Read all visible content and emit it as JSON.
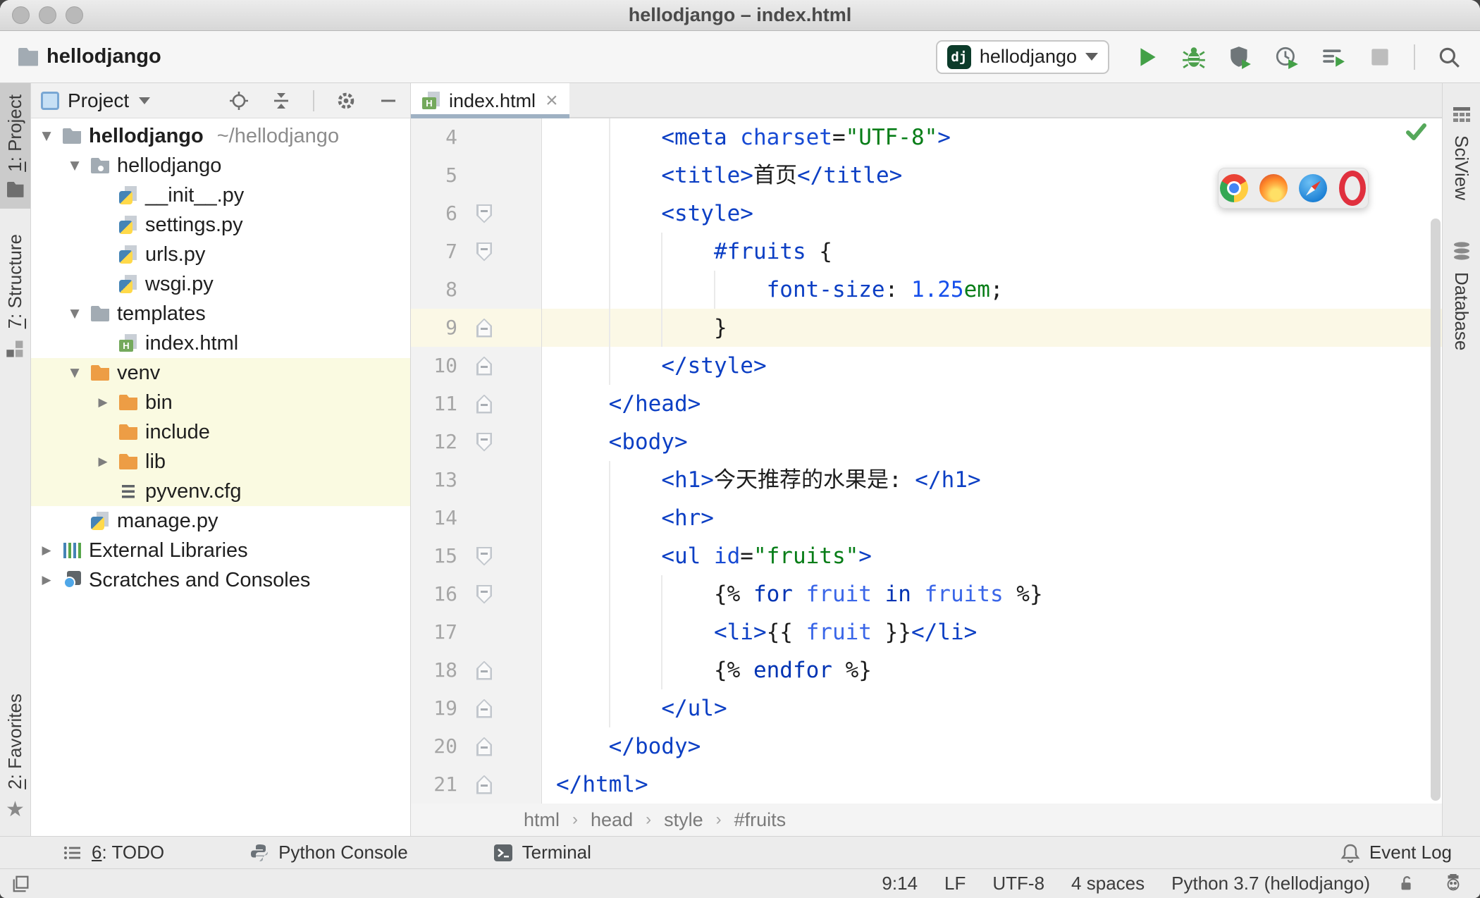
{
  "window": {
    "title": "hellodjango – index.html"
  },
  "navbar": {
    "project": "hellodjango",
    "run_badge": "dj",
    "run_config": "hellodjango"
  },
  "activity": {
    "left": [
      {
        "key": "1",
        "rest": ": Project"
      },
      {
        "key": "7",
        "rest": ": Structure"
      },
      {
        "key": "2",
        "rest": ": Favorites"
      }
    ],
    "right": [
      {
        "label": "SciView"
      },
      {
        "label": "Database"
      }
    ]
  },
  "project_panel": {
    "title": "Project",
    "tree": [
      {
        "label": "hellodjango",
        "suffix": "~/hellodjango",
        "icon": "folder",
        "level": 0,
        "arrow": "down",
        "bold": true
      },
      {
        "label": "hellodjango",
        "icon": "pkg",
        "level": 1,
        "arrow": "down"
      },
      {
        "label": "__init__.py",
        "icon": "pyfile",
        "level": 2,
        "arrow": "none"
      },
      {
        "label": "settings.py",
        "icon": "pyfile",
        "level": 2,
        "arrow": "none"
      },
      {
        "label": "urls.py",
        "icon": "pyfile",
        "level": 2,
        "arrow": "none"
      },
      {
        "label": "wsgi.py",
        "icon": "pyfile",
        "level": 2,
        "arrow": "none"
      },
      {
        "label": "templates",
        "icon": "folder",
        "level": 1,
        "arrow": "down"
      },
      {
        "label": "index.html",
        "icon": "htmlfile",
        "level": 2,
        "arrow": "none"
      },
      {
        "label": "venv",
        "icon": "ofolder",
        "level": 1,
        "arrow": "down",
        "hl": true
      },
      {
        "label": "bin",
        "icon": "ofolder",
        "level": 2,
        "arrow": "right",
        "hl": true
      },
      {
        "label": "include",
        "icon": "ofolder",
        "level": 2,
        "arrow": "none",
        "hl": true
      },
      {
        "label": "lib",
        "icon": "ofolder",
        "level": 2,
        "arrow": "right",
        "hl": true
      },
      {
        "label": "pyvenv.cfg",
        "icon": "cfgfile",
        "level": 2,
        "arrow": "none",
        "hl": true
      },
      {
        "label": "manage.py",
        "icon": "pyfile",
        "level": 1,
        "arrow": "none"
      },
      {
        "label": "External Libraries",
        "icon": "libs",
        "level": 0,
        "arrow": "right"
      },
      {
        "label": "Scratches and Consoles",
        "icon": "scratch",
        "level": 0,
        "arrow": "right"
      }
    ]
  },
  "editor": {
    "tab": "index.html",
    "breadcrumbs": [
      "html",
      "head",
      "style",
      "#fruits"
    ],
    "lines": [
      {
        "n": "4",
        "f": "",
        "hl": false,
        "t": [
          [
            "        ",
            "p"
          ],
          [
            "<meta ",
            "tag"
          ],
          [
            "charset",
            "attr"
          ],
          [
            "=",
            "p"
          ],
          [
            "\"UTF-8\"",
            "str"
          ],
          [
            ">",
            "tag"
          ]
        ]
      },
      {
        "n": "5",
        "f": "",
        "hl": false,
        "t": [
          [
            "        ",
            "p"
          ],
          [
            "<title>",
            "tag"
          ],
          [
            "首页",
            "p"
          ],
          [
            "</title>",
            "tag"
          ]
        ]
      },
      {
        "n": "6",
        "f": "d",
        "hl": false,
        "t": [
          [
            "        ",
            "p"
          ],
          [
            "<style>",
            "tag"
          ]
        ]
      },
      {
        "n": "7",
        "f": "d",
        "hl": false,
        "t": [
          [
            "            ",
            "p"
          ],
          [
            "#fruits",
            "tag"
          ],
          [
            " {",
            "p"
          ]
        ]
      },
      {
        "n": "8",
        "f": "",
        "hl": false,
        "t": [
          [
            "                ",
            "p"
          ],
          [
            "font-size",
            "tag"
          ],
          [
            ": ",
            "p"
          ],
          [
            "1.25",
            "num"
          ],
          [
            "em",
            "str"
          ],
          [
            ";",
            "p"
          ]
        ]
      },
      {
        "n": "9",
        "f": "u",
        "hl": true,
        "t": [
          [
            "            }",
            "p"
          ]
        ]
      },
      {
        "n": "10",
        "f": "u",
        "hl": false,
        "t": [
          [
            "        ",
            "p"
          ],
          [
            "</style>",
            "tag"
          ]
        ]
      },
      {
        "n": "11",
        "f": "u",
        "hl": false,
        "t": [
          [
            "    ",
            "p"
          ],
          [
            "</head>",
            "tag"
          ]
        ]
      },
      {
        "n": "12",
        "f": "d",
        "hl": false,
        "t": [
          [
            "    ",
            "p"
          ],
          [
            "<body>",
            "tag"
          ]
        ]
      },
      {
        "n": "13",
        "f": "",
        "hl": false,
        "t": [
          [
            "        ",
            "p"
          ],
          [
            "<h1>",
            "tag"
          ],
          [
            "今天推荐的水果是: ",
            "p"
          ],
          [
            "</h1>",
            "tag"
          ]
        ]
      },
      {
        "n": "14",
        "f": "",
        "hl": false,
        "t": [
          [
            "        ",
            "p"
          ],
          [
            "<hr>",
            "tag"
          ]
        ]
      },
      {
        "n": "15",
        "f": "d",
        "hl": false,
        "t": [
          [
            "        ",
            "p"
          ],
          [
            "<ul ",
            "tag"
          ],
          [
            "id",
            "attr"
          ],
          [
            "=",
            "p"
          ],
          [
            "\"fruits\"",
            "str"
          ],
          [
            ">",
            "tag"
          ]
        ]
      },
      {
        "n": "16",
        "f": "d",
        "hl": false,
        "t": [
          [
            "            {% ",
            "p"
          ],
          [
            "for",
            "kw"
          ],
          [
            " ",
            "p"
          ],
          [
            "fruit",
            "var"
          ],
          [
            " ",
            "p"
          ],
          [
            "in",
            "kw"
          ],
          [
            " ",
            "p"
          ],
          [
            "fruits",
            "var"
          ],
          [
            " %}",
            "p"
          ]
        ]
      },
      {
        "n": "17",
        "f": "",
        "hl": false,
        "t": [
          [
            "            ",
            "p"
          ],
          [
            "<li>",
            "tag"
          ],
          [
            "{{ ",
            "p"
          ],
          [
            "fruit",
            "var"
          ],
          [
            " }}",
            "p"
          ],
          [
            "</li>",
            "tag"
          ]
        ]
      },
      {
        "n": "18",
        "f": "u",
        "hl": false,
        "t": [
          [
            "            {% ",
            "p"
          ],
          [
            "endfor",
            "kw"
          ],
          [
            " %}",
            "p"
          ]
        ]
      },
      {
        "n": "19",
        "f": "u",
        "hl": false,
        "t": [
          [
            "        ",
            "p"
          ],
          [
            "</ul>",
            "tag"
          ]
        ]
      },
      {
        "n": "20",
        "f": "u",
        "hl": false,
        "t": [
          [
            "    ",
            "p"
          ],
          [
            "</body>",
            "tag"
          ]
        ]
      },
      {
        "n": "21",
        "f": "u",
        "hl": false,
        "t": [
          [
            "</html>",
            "tag"
          ]
        ]
      }
    ]
  },
  "popup_browsers": [
    "Chrome",
    "Firefox",
    "Safari",
    "Opera"
  ],
  "bottom_bar": {
    "todo_key": "6",
    "todo_rest": ": TODO",
    "python_console": "Python Console",
    "terminal": "Terminal",
    "event_log": "Event Log"
  },
  "status_bar": {
    "position": "9:14",
    "line_ending": "LF",
    "encoding": "UTF-8",
    "indent": "4 spaces",
    "interpreter": "Python 3.7 (hellodjango)"
  }
}
